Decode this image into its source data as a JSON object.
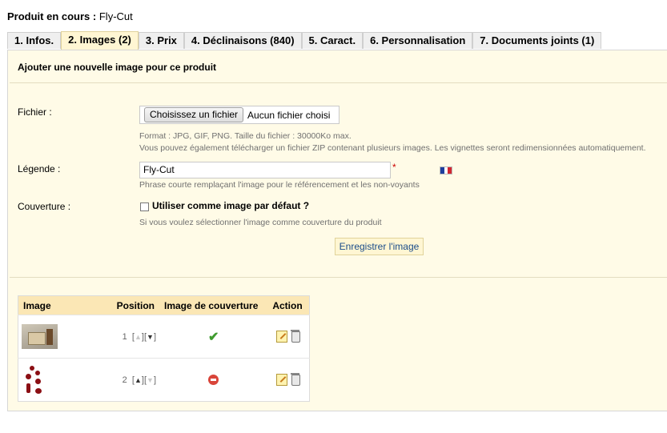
{
  "product": {
    "label": "Produit en cours :",
    "name": "Fly-Cut"
  },
  "tabs": [
    {
      "label": "1. Infos."
    },
    {
      "label": "2. Images (2)"
    },
    {
      "label": "3. Prix"
    },
    {
      "label": "4. Déclinaisons (840)"
    },
    {
      "label": "5. Caract."
    },
    {
      "label": "6. Personnalisation"
    },
    {
      "label": "7. Documents joints (1)"
    }
  ],
  "active_tab": "2. Images (2)",
  "form": {
    "title": "Ajouter une nouvelle image pour ce produit",
    "file": {
      "label": "Fichier :",
      "button": "Choisissez un fichier",
      "status": "Aucun fichier choisi",
      "hint1": "Format : JPG, GIF, PNG. Taille du fichier : 30000Ko max.",
      "hint2": "Vous pouvez également télécharger un fichier ZIP contenant plusieurs images. Les vignettes seront redimensionnées automatiquement."
    },
    "legend": {
      "label": "Légende :",
      "value": "Fly-Cut",
      "required": "*",
      "hint": "Phrase courte remplaçant l'image pour le référencement et les non-voyants",
      "flag_colors": [
        "#1f3e9c",
        "#ffffff",
        "#d22630"
      ]
    },
    "cover": {
      "label": "Couverture :",
      "checkbox_label": "Utiliser comme image par défaut ?",
      "checked": false,
      "hint": "Si vous voulez sélectionner l'image comme couverture du produit"
    },
    "save_button": "Enregistrer l'image"
  },
  "table": {
    "headers": {
      "image": "Image",
      "position": "Position",
      "cover": "Image de couverture",
      "action": "Action"
    },
    "rows": [
      {
        "position": "1",
        "up_enabled": false,
        "down_enabled": true,
        "is_cover": true,
        "cover_icon": "check-icon"
      },
      {
        "position": "2",
        "up_enabled": true,
        "down_enabled": false,
        "is_cover": false,
        "cover_icon": "no-entry-icon"
      }
    ]
  },
  "colors": {
    "panel_bg": "#fffbe7",
    "active_tab_bg": "#fff6d3",
    "table_header_bg": "#fbe7b5",
    "link_blue": "#1a4c8a"
  }
}
